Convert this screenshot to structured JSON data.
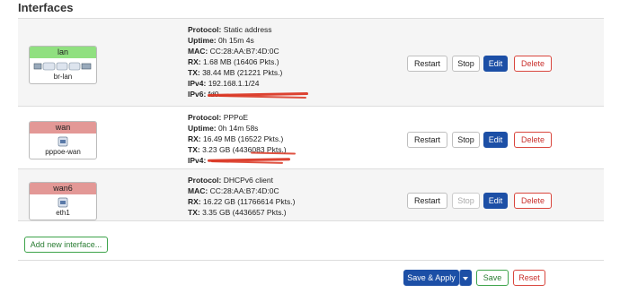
{
  "page": {
    "title": "Interfaces"
  },
  "interfaces": [
    {
      "name": "lan",
      "device": "br-lan",
      "details": [
        {
          "label": "Protocol:",
          "value": "Static address"
        },
        {
          "label": "Uptime:",
          "value": "0h 15m 4s"
        },
        {
          "label": "MAC:",
          "value": "CC:28:AA:B7:4D:0C"
        },
        {
          "label": "RX:",
          "value": "1.68 MB (16406 Pkts.)"
        },
        {
          "label": "TX:",
          "value": "38.44 MB (21221 Pkts.)"
        },
        {
          "label": "IPv4:",
          "value": "192.168.1.1/24"
        },
        {
          "label": "IPv6:",
          "value": "fd0"
        }
      ],
      "actions": {
        "restart": "Restart",
        "stop": "Stop",
        "edit": "Edit",
        "delete": "Delete"
      }
    },
    {
      "name": "wan",
      "device": "pppoe-wan",
      "details": [
        {
          "label": "Protocol:",
          "value": "PPPoE"
        },
        {
          "label": "Uptime:",
          "value": "0h 14m 58s"
        },
        {
          "label": "RX:",
          "value": "16.49 MB (16522 Pkts.)"
        },
        {
          "label": "TX:",
          "value": "3.23 GB (4436083 Pkts.)"
        },
        {
          "label": "IPv4:",
          "value": ""
        }
      ],
      "actions": {
        "restart": "Restart",
        "stop": "Stop",
        "edit": "Edit",
        "delete": "Delete"
      }
    },
    {
      "name": "wan6",
      "device": "eth1",
      "details": [
        {
          "label": "Protocol:",
          "value": "DHCPv6 client"
        },
        {
          "label": "MAC:",
          "value": "CC:28:AA:B7:4D:0C"
        },
        {
          "label": "RX:",
          "value": "16.22 GB (11766614 Pkts.)"
        },
        {
          "label": "TX:",
          "value": "3.35 GB (4436657 Pkts.)"
        }
      ],
      "actions": {
        "restart": "Restart",
        "stop": "Stop",
        "edit": "Edit",
        "delete": "Delete"
      }
    }
  ],
  "add_interface": "Add new interface...",
  "footer": {
    "apply": "Save & Apply",
    "save": "Save",
    "reset": "Reset"
  },
  "colors": {
    "primary": "#1c4fa6",
    "danger": "#d9463d",
    "success": "#3da34a",
    "lan_badge": "#90e080",
    "wan_badge": "#e39896",
    "redaction": "#d9321f"
  }
}
